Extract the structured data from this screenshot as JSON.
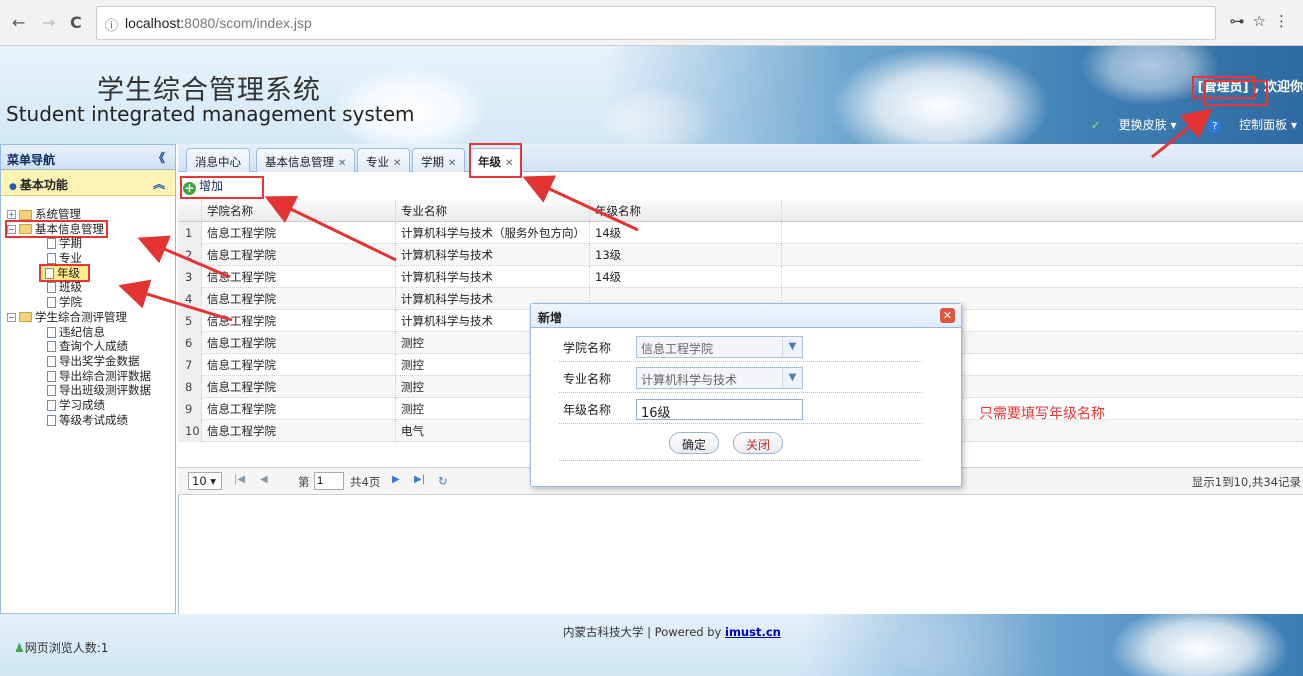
{
  "browser": {
    "back": "←",
    "forward": "→",
    "reload": "C",
    "info": "ⓘ",
    "url_host": "localhost:",
    "url_rest": "8080/scom/index.jsp",
    "key_icon": "⊶",
    "star_icon": "☆",
    "menu_icon": "⋮"
  },
  "header": {
    "title_cn": "学生综合管理系统",
    "title_en": "Student integrated management system",
    "role": "[管理员]",
    "welcome": ", 欢迎你",
    "skin_label": "更换皮肤",
    "panel_label": "控制面板"
  },
  "leftnav": {
    "title": "菜单导航",
    "collapse": "《",
    "section": "基本功能",
    "section_toggle": "︽",
    "tree": [
      {
        "label": "系统管理",
        "type": "folder",
        "pm": "+"
      },
      {
        "label": "基本信息管理",
        "type": "folder",
        "pm": "−"
      },
      {
        "label": "学期",
        "type": "file"
      },
      {
        "label": "专业",
        "type": "file"
      },
      {
        "label": "年级",
        "type": "file"
      },
      {
        "label": "班级",
        "type": "file"
      },
      {
        "label": "学院",
        "type": "file"
      },
      {
        "label": "学生综合测评管理",
        "type": "folder",
        "pm": "−"
      },
      {
        "label": "违纪信息",
        "type": "file"
      },
      {
        "label": "查询个人成绩",
        "type": "file"
      },
      {
        "label": "导出奖学金数据",
        "type": "file"
      },
      {
        "label": "导出综合测评数据",
        "type": "file"
      },
      {
        "label": "导出班级测评数据",
        "type": "file"
      },
      {
        "label": "学习成绩",
        "type": "file"
      },
      {
        "label": "等级考试成绩",
        "type": "file"
      }
    ]
  },
  "tabs": [
    {
      "label": "消息中心",
      "close": false
    },
    {
      "label": "基本信息管理",
      "close": true
    },
    {
      "label": "专业",
      "close": true
    },
    {
      "label": "学期",
      "close": true
    },
    {
      "label": "年级",
      "close": true
    }
  ],
  "toolbar": {
    "add_label": "增加"
  },
  "grid": {
    "columns": [
      "学院名称",
      "专业名称",
      "年级名称"
    ],
    "rows": [
      [
        "1",
        "信息工程学院",
        "计算机科学与技术（服务外包方向）",
        "14级"
      ],
      [
        "2",
        "信息工程学院",
        "计算机科学与技术",
        "13级"
      ],
      [
        "3",
        "信息工程学院",
        "计算机科学与技术",
        "14级"
      ],
      [
        "4",
        "信息工程学院",
        "计算机科学与技术",
        ""
      ],
      [
        "5",
        "信息工程学院",
        "计算机科学与技术",
        ""
      ],
      [
        "6",
        "信息工程学院",
        "测控",
        ""
      ],
      [
        "7",
        "信息工程学院",
        "测控",
        ""
      ],
      [
        "8",
        "信息工程学院",
        "测控",
        ""
      ],
      [
        "9",
        "信息工程学院",
        "测控",
        ""
      ],
      [
        "10",
        "信息工程学院",
        "电气",
        ""
      ]
    ]
  },
  "pager": {
    "page_size": "10 ▾",
    "page_prefix": "第",
    "page_value": "1",
    "page_total": "共4页",
    "summary": "显示1到10,共34记录"
  },
  "dialog": {
    "title": "新增",
    "close": "✕",
    "fields": [
      {
        "label": "学院名称",
        "value": "信息工程学院",
        "kind": "combo"
      },
      {
        "label": "专业名称",
        "value": "计算机科学与技术",
        "kind": "combo"
      },
      {
        "label": "年级名称",
        "value": "16级",
        "kind": "text"
      }
    ],
    "ok_label": "确定",
    "close_label": "关闭"
  },
  "annotation": "只需要填写年级名称",
  "footer": {
    "visitors": "网页浏览人数:1",
    "powered_prefix": "内蒙古科技大学 | Powered by ",
    "powered_link": "imust.cn"
  },
  "colors": {
    "accent": "#99bbe8",
    "arrow": "#e33333"
  }
}
